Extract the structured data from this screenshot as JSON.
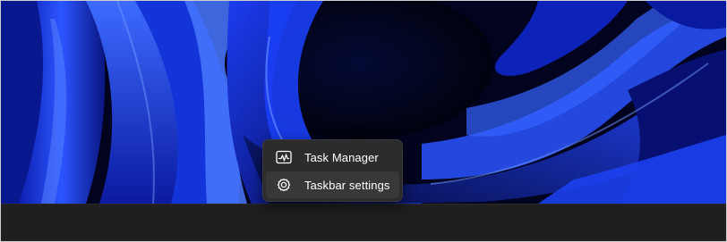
{
  "wallpaper": {
    "theme": "Windows 11 Bloom",
    "colors": {
      "deep": "#020420",
      "mid": "#0a1a9e",
      "bright": "#1f4bff",
      "glow": "#4d7cff"
    }
  },
  "taskbar": {
    "color": "#1f1f1f"
  },
  "context_menu": {
    "items": [
      {
        "label": "Task Manager",
        "icon": "task-manager-icon"
      },
      {
        "label": "Taskbar settings",
        "icon": "gear-icon",
        "hovered": true
      }
    ],
    "colors": {
      "background": "#2c2c2c",
      "hover": "#383838",
      "text": "#ffffff"
    }
  }
}
